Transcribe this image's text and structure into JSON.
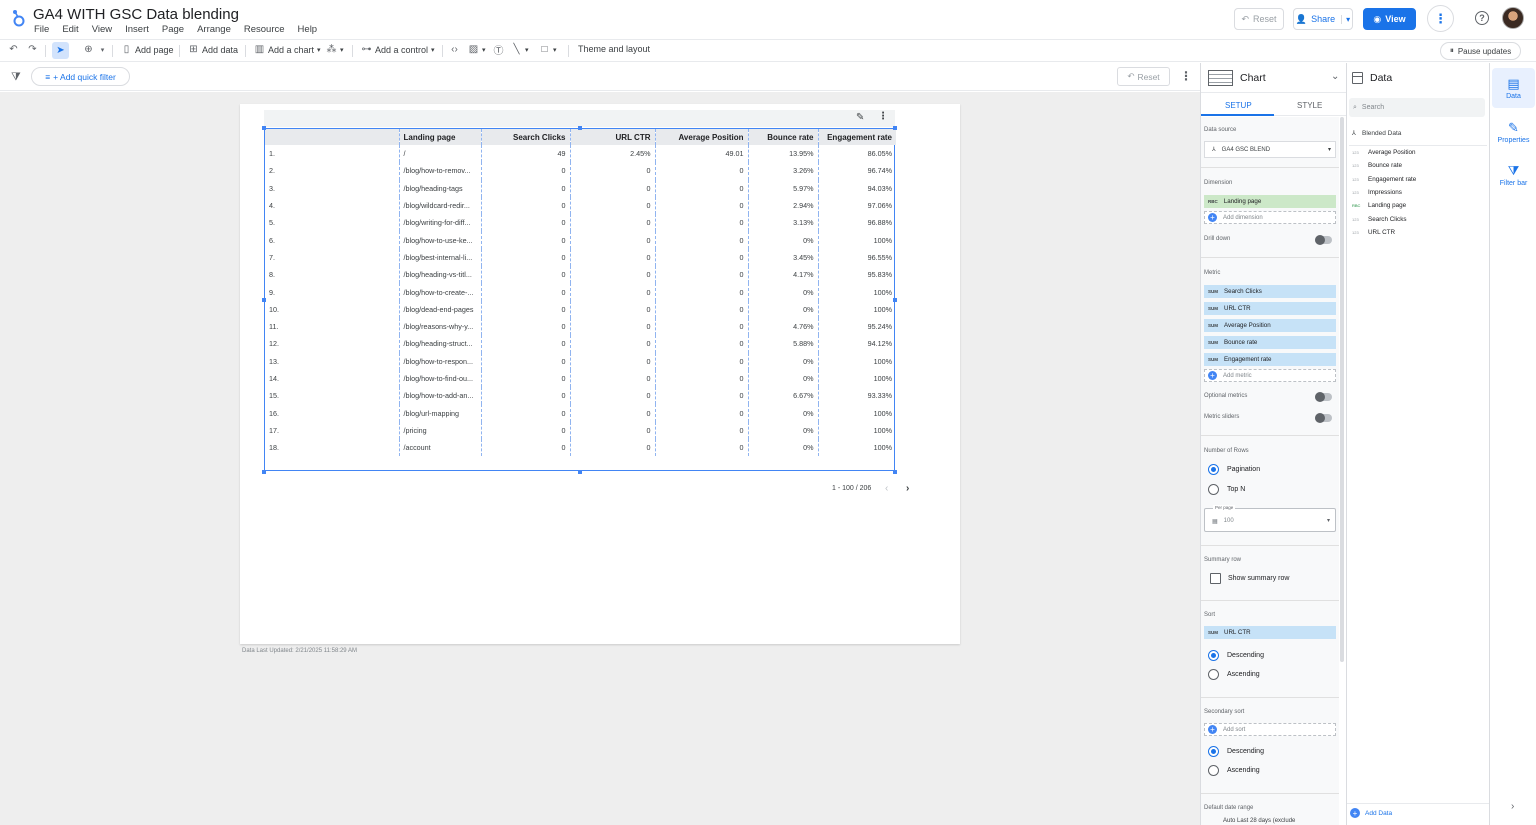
{
  "header": {
    "title": "GA4 WITH GSC Data blending",
    "menu": [
      "File",
      "Edit",
      "View",
      "Insert",
      "Page",
      "Arrange",
      "Resource",
      "Help"
    ],
    "reset_label": "Reset",
    "share_label": "Share",
    "view_label": "View"
  },
  "toolbar": {
    "add_page": "Add page",
    "add_data": "Add data",
    "add_chart": "Add a chart",
    "add_control": "Add a control",
    "theme": "Theme and layout",
    "pause": "Pause updates"
  },
  "filterbar": {
    "quick_filter": "+ Add quick filter",
    "reset_label": "Reset"
  },
  "canvas": {
    "last_updated": "Data Last Updated: 2/21/2025 11:58:29 AM"
  },
  "table": {
    "columns": [
      "",
      "Landing page",
      "Search Clicks",
      "URL CTR",
      "Average Position",
      "Bounce rate",
      "Engagement rate"
    ],
    "rows": [
      [
        "1.",
        "/",
        "49",
        "2.45%",
        "49.01",
        "13.95%",
        "86.05%"
      ],
      [
        "2.",
        "/blog/how-to-remov...",
        "0",
        "0",
        "0",
        "3.26%",
        "96.74%"
      ],
      [
        "3.",
        "/blog/heading-tags",
        "0",
        "0",
        "0",
        "5.97%",
        "94.03%"
      ],
      [
        "4.",
        "/blog/wildcard-redir...",
        "0",
        "0",
        "0",
        "2.94%",
        "97.06%"
      ],
      [
        "5.",
        "/blog/writing-for-diff...",
        "0",
        "0",
        "0",
        "3.13%",
        "96.88%"
      ],
      [
        "6.",
        "/blog/how-to-use-ke...",
        "0",
        "0",
        "0",
        "0%",
        "100%"
      ],
      [
        "7.",
        "/blog/best-internal-li...",
        "0",
        "0",
        "0",
        "3.45%",
        "96.55%"
      ],
      [
        "8.",
        "/blog/heading-vs-titl...",
        "0",
        "0",
        "0",
        "4.17%",
        "95.83%"
      ],
      [
        "9.",
        "/blog/how-to-create-...",
        "0",
        "0",
        "0",
        "0%",
        "100%"
      ],
      [
        "10.",
        "/blog/dead-end-pages",
        "0",
        "0",
        "0",
        "0%",
        "100%"
      ],
      [
        "11.",
        "/blog/reasons-why-y...",
        "0",
        "0",
        "0",
        "4.76%",
        "95.24%"
      ],
      [
        "12.",
        "/blog/heading-struct...",
        "0",
        "0",
        "0",
        "5.88%",
        "94.12%"
      ],
      [
        "13.",
        "/blog/how-to-respon...",
        "0",
        "0",
        "0",
        "0%",
        "100%"
      ],
      [
        "14.",
        "/blog/how-to-find-ou...",
        "0",
        "0",
        "0",
        "0%",
        "100%"
      ],
      [
        "15.",
        "/blog/how-to-add-an...",
        "0",
        "0",
        "0",
        "6.67%",
        "93.33%"
      ],
      [
        "16.",
        "/blog/url-mapping",
        "0",
        "0",
        "0",
        "0%",
        "100%"
      ],
      [
        "17.",
        "/pricing",
        "0",
        "0",
        "0",
        "0%",
        "100%"
      ],
      [
        "18.",
        "/account",
        "0",
        "0",
        "0",
        "0%",
        "100%"
      ]
    ],
    "pagination": "1 - 100 / 206"
  },
  "properties": {
    "title": "Chart",
    "tab_setup": "SETUP",
    "tab_style": "STYLE",
    "data_source_label": "Data source",
    "data_source": "GA4 GSC BLEND",
    "dimension_label": "Dimension",
    "dimension": "Landing page",
    "dimension_tag": "RBC",
    "add_dimension": "Add dimension",
    "drill_down": "Drill down",
    "metric_label": "Metric",
    "metric_tag": "SUM",
    "metrics": [
      "Search Clicks",
      "URL CTR",
      "Average Position",
      "Bounce rate",
      "Engagement rate"
    ],
    "add_metric": "Add metric",
    "optional_metrics": "Optional metrics",
    "metric_sliders": "Metric sliders",
    "rows_label": "Number of Rows",
    "pagination": "Pagination",
    "top_n": "Top N",
    "per_page_label": "Per page",
    "per_page": "100",
    "summary_label": "Summary row",
    "show_summary": "Show summary row",
    "sort_label": "Sort",
    "sort_field": "URL CTR",
    "descending": "Descending",
    "ascending": "Ascending",
    "secondary_sort_label": "Secondary sort",
    "add_sort": "Add sort",
    "date_range_label": "Default date range",
    "date_range_value": "Auto  Last 28 days (exclude"
  },
  "datapanel": {
    "title": "Data",
    "search_placeholder": "Search",
    "source": "Blended Data",
    "fields": [
      {
        "tag": "123",
        "name": "Average Position"
      },
      {
        "tag": "123",
        "name": "Bounce rate"
      },
      {
        "tag": "123",
        "name": "Engagement rate"
      },
      {
        "tag": "123",
        "name": "Impressions"
      },
      {
        "tag": "RBC",
        "name": "Landing page"
      },
      {
        "tag": "123",
        "name": "Search Clicks"
      },
      {
        "tag": "123",
        "name": "URL CTR"
      }
    ],
    "add_data": "Add Data"
  },
  "rail": {
    "data": "Data",
    "properties": "Properties",
    "filter_bar": "Filter bar"
  }
}
